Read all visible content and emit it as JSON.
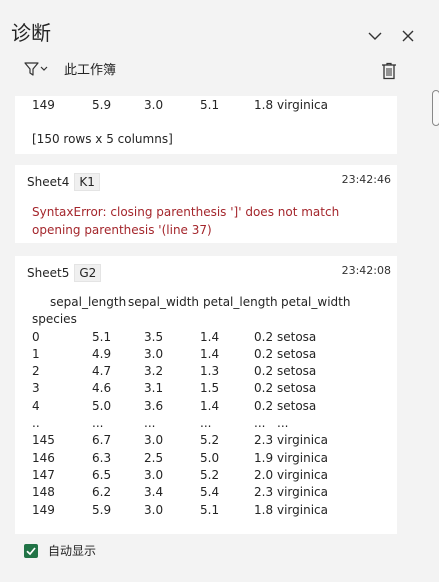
{
  "pane": {
    "title": "诊断",
    "scope_label": "此工作簿",
    "icons": {
      "collapse": "chevron-down-icon",
      "close": "close-icon",
      "filter": "filter-icon",
      "trash": "trash-icon"
    }
  },
  "cards": [
    {
      "rows": [
        [
          "149",
          "5.9",
          "3.0",
          "5.1",
          "1.8",
          "virginica"
        ]
      ],
      "summary": "[150 rows x 5 columns]"
    },
    {
      "sheet": "Sheet4",
      "cell": "K1",
      "time": "23:42:46",
      "error": "SyntaxError: closing parenthesis ']' does not match opening parenthesis '(line 37)"
    },
    {
      "sheet": "Sheet5",
      "cell": "G2",
      "time": "23:42:08",
      "header_cols": [
        "sepal_length",
        "sepal_width",
        "petal_length",
        "petal_width"
      ],
      "index_name": "species",
      "rows": [
        [
          "0",
          "5.1",
          "3.5",
          "1.4",
          "0.2",
          "setosa"
        ],
        [
          "1",
          "4.9",
          "3.0",
          "1.4",
          "0.2",
          "setosa"
        ],
        [
          "2",
          "4.7",
          "3.2",
          "1.3",
          "0.2",
          "setosa"
        ],
        [
          "3",
          "4.6",
          "3.1",
          "1.5",
          "0.2",
          "setosa"
        ],
        [
          "4",
          "5.0",
          "3.6",
          "1.4",
          "0.2",
          "setosa"
        ],
        [
          "..",
          "...",
          "...",
          "...",
          "...",
          "..."
        ],
        [
          "145",
          "6.7",
          "3.0",
          "5.2",
          "2.3",
          "virginica"
        ],
        [
          "146",
          "6.3",
          "2.5",
          "5.0",
          "1.9",
          "virginica"
        ],
        [
          "147",
          "6.5",
          "3.0",
          "5.2",
          "2.0",
          "virginica"
        ],
        [
          "148",
          "6.2",
          "3.4",
          "5.4",
          "2.3",
          "virginica"
        ],
        [
          "149",
          "5.9",
          "3.0",
          "5.1",
          "1.8",
          "virginica"
        ]
      ]
    }
  ],
  "footer": {
    "auto_show_label": "自动显示",
    "auto_show_checked": true
  },
  "colors": {
    "accent": "#217346",
    "error": "#a4262c",
    "pane_bg": "#f3f3f3",
    "card_bg": "#ffffff"
  }
}
